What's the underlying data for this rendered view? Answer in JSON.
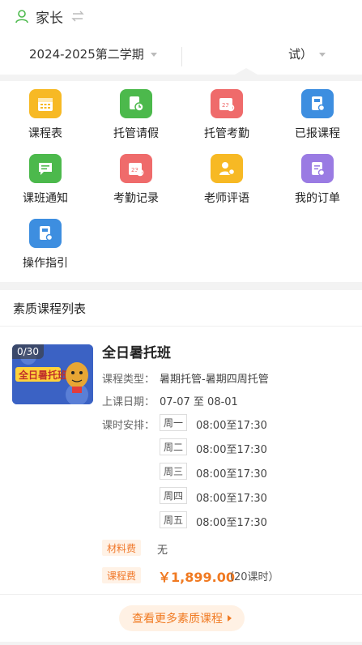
{
  "header": {
    "role": "家长"
  },
  "term": {
    "selected": "2024-2025第二学期"
  },
  "class_select": {
    "selected": "试）"
  },
  "grid": [
    {
      "label": "课程表",
      "icon": "calendar-icon",
      "color": "#f7b924"
    },
    {
      "label": "托管请假",
      "icon": "leave-clock-icon",
      "color": "#4cb94c"
    },
    {
      "label": "托管考勤",
      "icon": "attendance-calendar-icon",
      "color": "#ef6b6b"
    },
    {
      "label": "已报课程",
      "icon": "book-icon",
      "color": "#3d8ee0"
    },
    {
      "label": "课班通知",
      "icon": "message-icon",
      "color": "#4cb94c"
    },
    {
      "label": "考勤记录",
      "icon": "calendar-search-icon",
      "color": "#ef6b6b"
    },
    {
      "label": "老师评语",
      "icon": "teacher-comment-icon",
      "color": "#f7b924"
    },
    {
      "label": "我的订单",
      "icon": "order-icon",
      "color": "#9a7be3"
    },
    {
      "label": "操作指引",
      "icon": "guide-book-icon",
      "color": "#3d8ee0"
    }
  ],
  "section": {
    "title": "素质课程列表"
  },
  "course": {
    "count": "0/30",
    "thumb_text": "全日暑托班",
    "title": "全日暑托班",
    "type_label": "课程类型：",
    "type_value": "暑期托管-暑期四周托管",
    "date_label": "上课日期：",
    "date_value": "07-07 至 08-01",
    "schedule_label": "课时安排：",
    "schedule": [
      {
        "day": "周一",
        "time": "08:00至17:30"
      },
      {
        "day": "周二",
        "time": "08:00至17:30"
      },
      {
        "day": "周三",
        "time": "08:00至17:30"
      },
      {
        "day": "周四",
        "time": "08:00至17:30"
      },
      {
        "day": "周五",
        "time": "08:00至17:30"
      }
    ],
    "material_tag": "材料费",
    "material_value": "无",
    "fee_tag": "课程费",
    "price": "￥1,899.00",
    "price_note": "（20课时）"
  },
  "more_button": {
    "label": "查看更多素质课程"
  },
  "colors": {
    "accent": "#f07a22",
    "green": "#4cb94c"
  }
}
